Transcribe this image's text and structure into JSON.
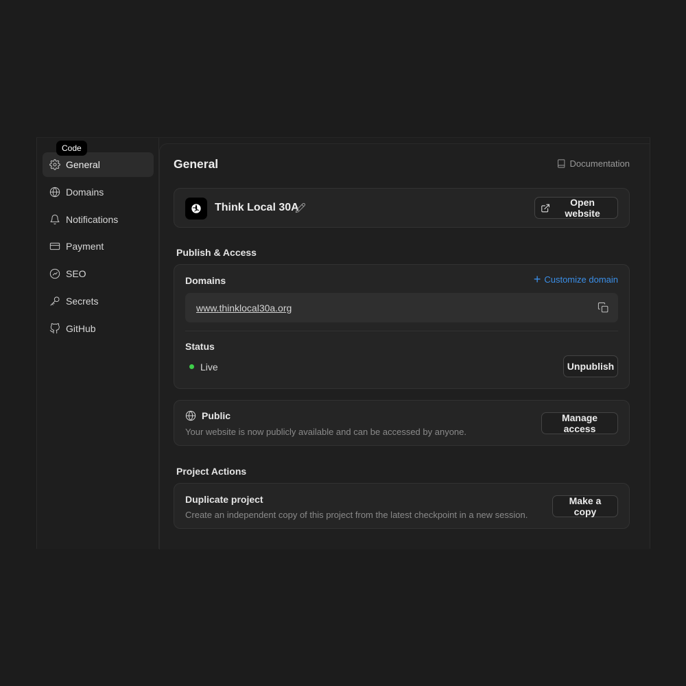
{
  "tooltip": "Code",
  "sidebar": {
    "items": [
      {
        "label": "General",
        "icon": "gear-icon",
        "active": true
      },
      {
        "label": "Domains",
        "icon": "globe-icon"
      },
      {
        "label": "Notifications",
        "icon": "bell-icon"
      },
      {
        "label": "Payment",
        "icon": "credit-card-icon"
      },
      {
        "label": "SEO",
        "icon": "gauge-icon"
      },
      {
        "label": "Secrets",
        "icon": "key-icon"
      },
      {
        "label": "GitHub",
        "icon": "github-icon"
      }
    ]
  },
  "header": {
    "title": "General",
    "doc_link": "Documentation"
  },
  "project": {
    "name": "Think Local 30A",
    "open_label": "Open website"
  },
  "publish": {
    "section_title": "Publish & Access",
    "domains_label": "Domains",
    "customize_label": "Customize domain",
    "domain_url": "www.thinklocal30a.org",
    "status_label": "Status",
    "status_value": "Live",
    "status_color": "#3ecf4a",
    "unpublish_label": "Unpublish"
  },
  "access": {
    "title": "Public",
    "description": "Your website is now publicly available and can be accessed by anyone.",
    "manage_label": "Manage access"
  },
  "actions": {
    "section_title": "Project Actions",
    "duplicate_title": "Duplicate project",
    "duplicate_desc": "Create an independent copy of this project from the latest checkpoint in a new session.",
    "copy_label": "Make a copy"
  },
  "colors": {
    "accent": "#3b8fe8",
    "background": "#1c1c1c"
  }
}
